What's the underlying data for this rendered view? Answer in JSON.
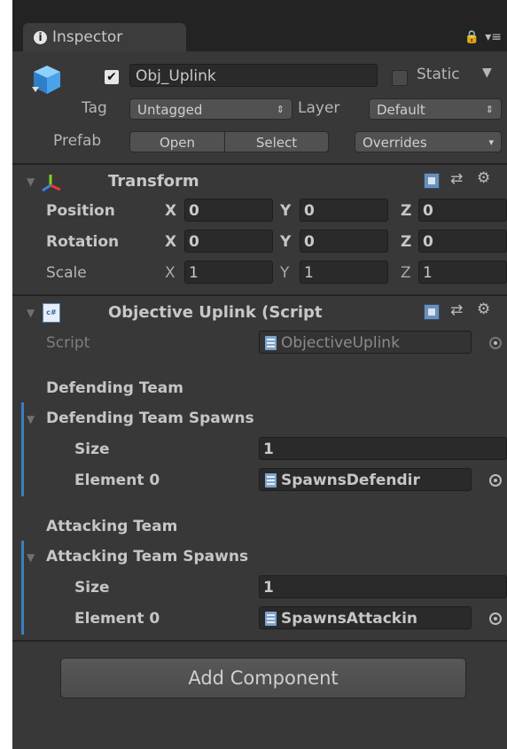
{
  "tab": {
    "icon": "info-icon",
    "label": "Inspector"
  },
  "tab_controls": {
    "lock": "lock-icon",
    "menu": "menu-icon"
  },
  "header": {
    "object_name": "Obj_Uplink",
    "static_label": "Static",
    "tag_label": "Tag",
    "tag_value": "Untagged",
    "layer_label": "Layer",
    "layer_value": "Default",
    "prefab_label": "Prefab",
    "open_label": "Open",
    "select_label": "Select",
    "overrides_label": "Overrides"
  },
  "transform": {
    "title": "Transform",
    "rows": [
      {
        "label": "Position",
        "x": "0",
        "y": "0",
        "z": "0"
      },
      {
        "label": "Rotation",
        "x": "0",
        "y": "0",
        "z": "0"
      },
      {
        "label": "Scale",
        "x": "1",
        "y": "1",
        "z": "1"
      }
    ],
    "axis_x": "X",
    "axis_y": "Y",
    "axis_z": "Z"
  },
  "script_component": {
    "title": "Objective Uplink (Script",
    "script_label": "Script",
    "script_value": "ObjectiveUplink",
    "defending_header": "Defending Team",
    "defending_spawns_label": "Defending Team Spawns",
    "defending_size_label": "Size",
    "defending_size_value": "1",
    "defending_element_label": "Element 0",
    "defending_element_value": "SpawnsDefendir",
    "attacking_header": "Attacking Team",
    "attacking_spawns_label": "Attacking Team Spawns",
    "attacking_size_label": "Size",
    "attacking_size_value": "1",
    "attacking_element_label": "Element 0",
    "attacking_element_value": "SpawnsAttackin"
  },
  "add_component_label": "Add Component",
  "colors": {
    "panel": "#383838",
    "accent": "#3a7fc3"
  }
}
